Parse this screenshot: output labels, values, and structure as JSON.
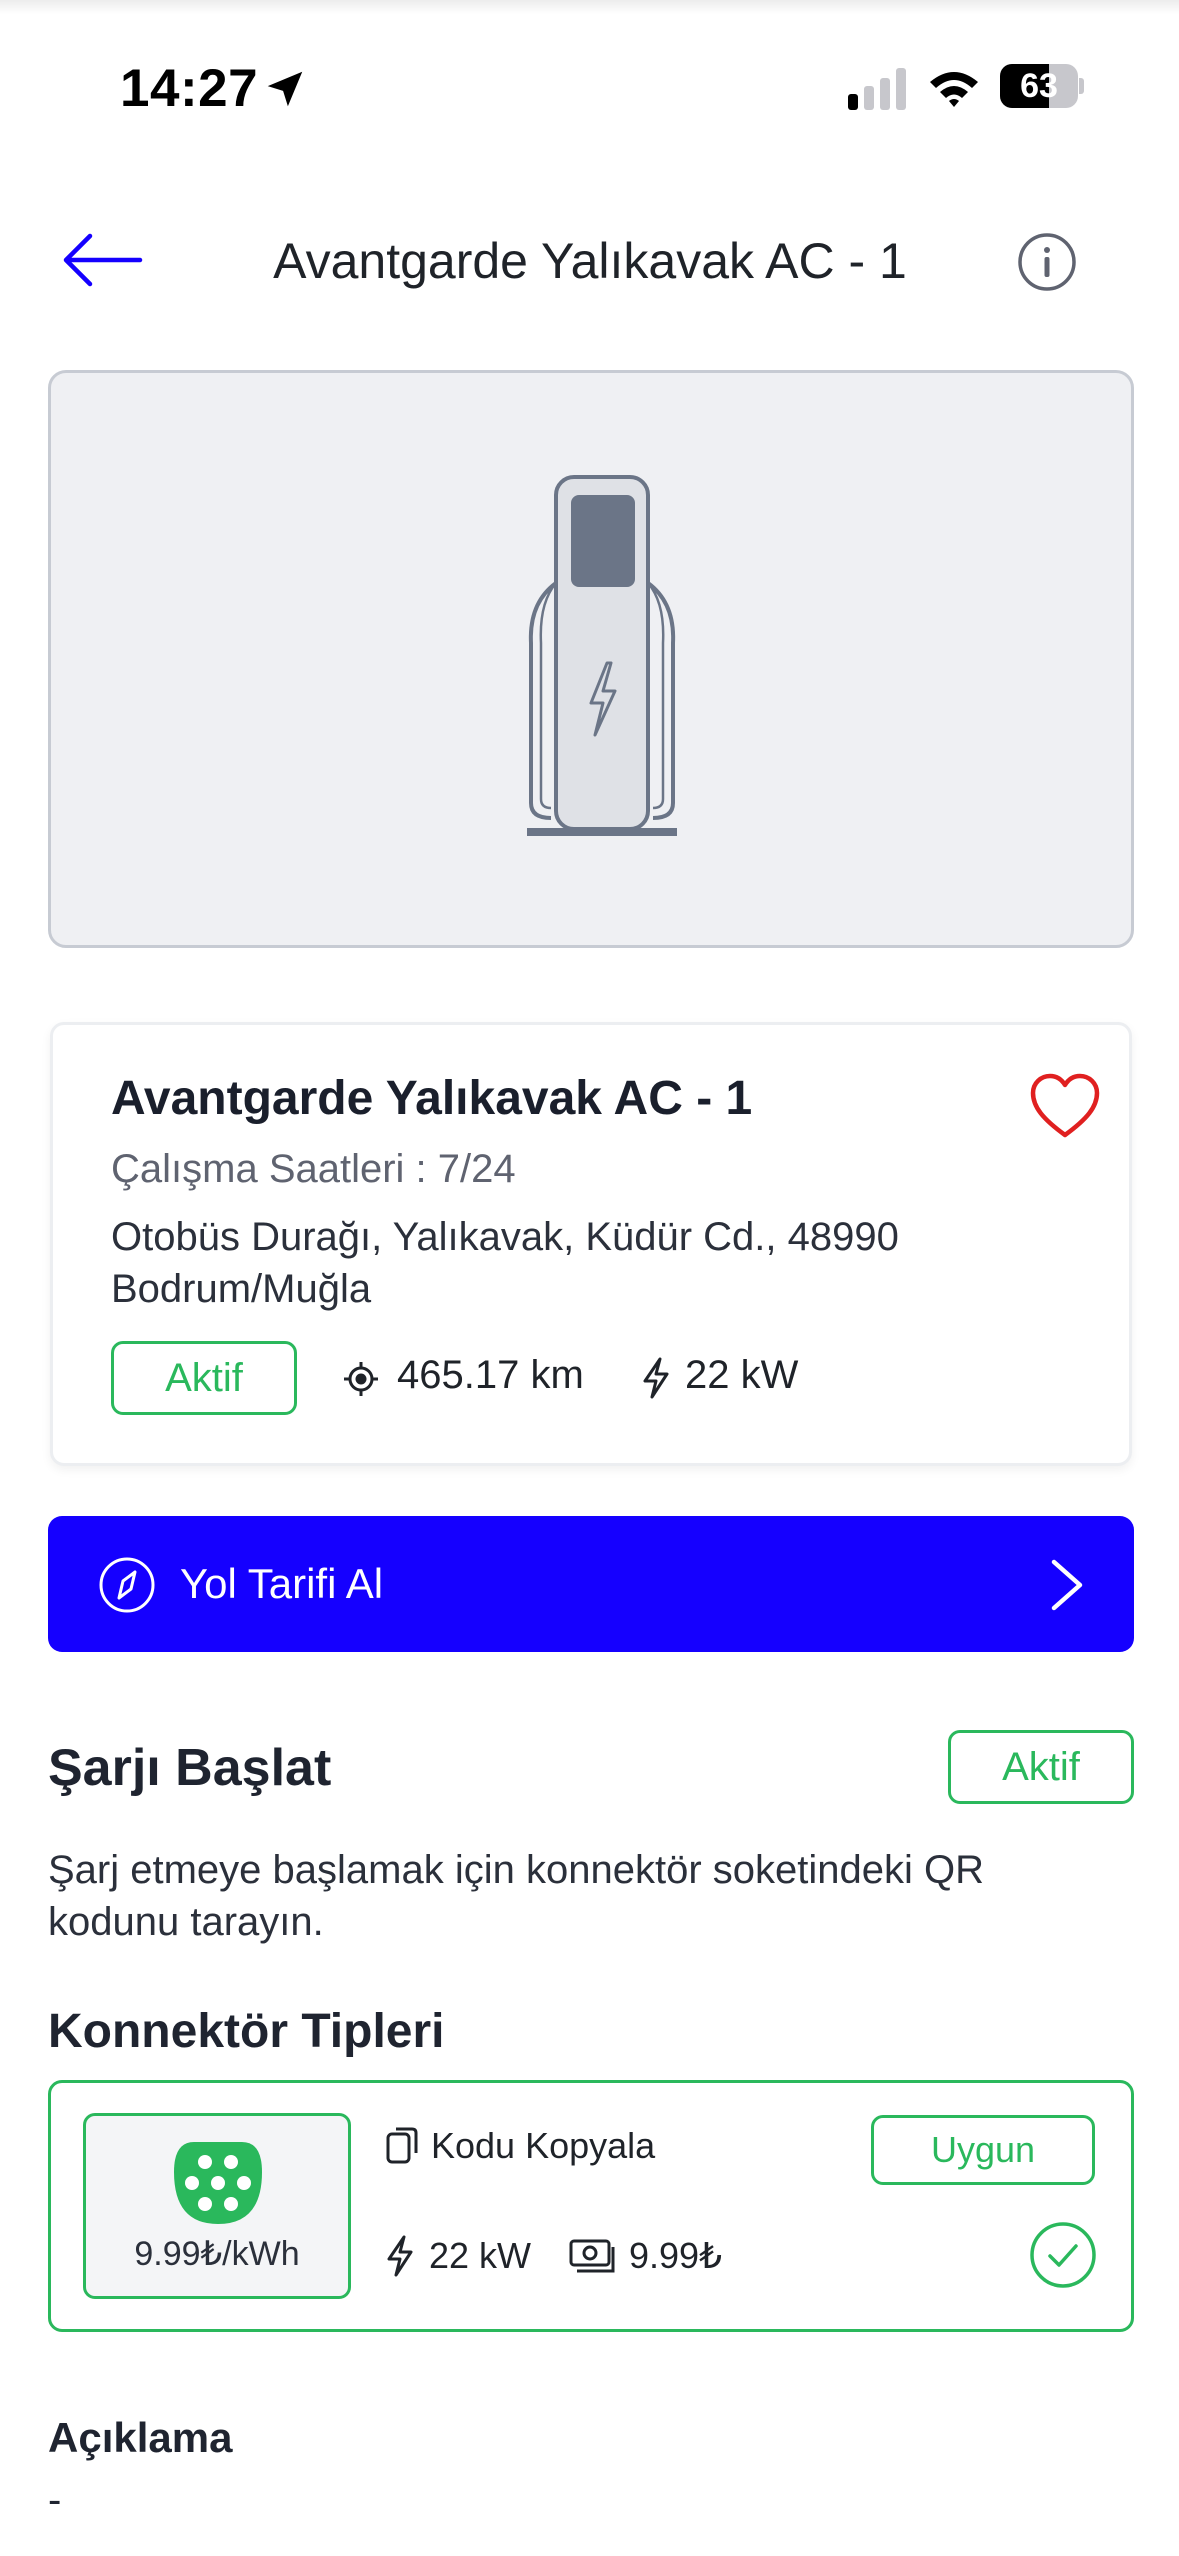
{
  "status_bar": {
    "time": "14:27",
    "battery_level": "63",
    "battery_fraction": 0.63
  },
  "header": {
    "title": "Avantgarde Yalıkavak AC - 1"
  },
  "station": {
    "name": "Avantgarde Yalıkavak AC - 1",
    "hours_label": "Çalışma Saatleri :",
    "hours_value": "7/24",
    "hours": "Çalışma Saatleri : 7/24",
    "address": "Otobüs Durağı, Yalıkavak, Küdür Cd., 48990 Bodrum/Muğla",
    "status": "Aktif",
    "distance": "465.17 km",
    "power": "22 kW"
  },
  "directions": {
    "label": "Yol Tarifi Al"
  },
  "start_charging": {
    "title": "Şarjı Başlat",
    "status": "Aktif",
    "description": "Şarj etmeye başlamak için konnektör soketindeki QR kodunu tarayın."
  },
  "connectors": {
    "title": "Konnektör Tipleri",
    "items": [
      {
        "price_per_kwh": "9.99₺/kWh",
        "copy_label": "Kodu Kopyala",
        "availability": "Uygun",
        "power": "22 kW",
        "price": "9.99₺"
      }
    ]
  },
  "description": {
    "title": "Açıklama",
    "text": "-"
  },
  "colors": {
    "primary": "#1500ff",
    "success": "#2ab85c",
    "favorite": "#e02020"
  }
}
